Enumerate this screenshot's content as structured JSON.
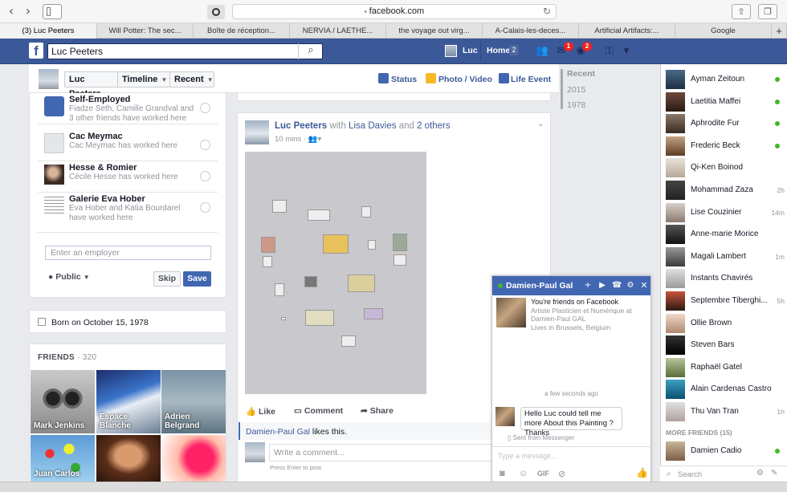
{
  "browser": {
    "url": "facebook.com",
    "tabs": [
      "(3) Luc Peeters",
      "Will Potter: The sec...",
      "Boîte de réception...",
      "NERVIA / LAETHE...",
      "the voyage out virg...",
      "A-Calais-les-deces...",
      "Artificial Artifacts:...",
      "Google"
    ],
    "new_tab": "+"
  },
  "topbar": {
    "logo": "f",
    "search_value": "Luc Peeters",
    "user": "Luc",
    "home": "Home",
    "home_count": "2",
    "messages_badge": "1",
    "notifications_badge": "2"
  },
  "profile_nav": {
    "name": "Luc Peeters",
    "timeline": "Timeline",
    "recent": "Recent",
    "status": "Status",
    "photo_video": "Photo / Video",
    "life_event": "Life Event"
  },
  "work": {
    "items": [
      {
        "name": "Self-Employed",
        "desc": "Fiadze Seth, Camille Grandval and 3 other friends have worked here"
      },
      {
        "name": "Cac Meymac",
        "desc": "Cac Meymac has worked here"
      },
      {
        "name": "Hesse & Romier",
        "desc": "Cécile Hesse has worked here"
      },
      {
        "name": "Galerie Eva Hober",
        "desc": "Eva Hober and Katia Bourdarel have worked here"
      }
    ],
    "employer_placeholder": "Enter an employer",
    "privacy": "Public",
    "skip": "Skip",
    "save": "Save"
  },
  "born": "Born on October 15, 1978",
  "friends": {
    "title": "FRIENDS",
    "count": "· 320",
    "tiles": [
      "Mark Jenkins",
      "Espace Blanche",
      "Adrien Belgrand",
      "Juan Carlos",
      "",
      ""
    ]
  },
  "post": {
    "author": "Luc Peeters",
    "with": " with ",
    "tagged": "Lisa Davies",
    "and": " and ",
    "others": "2 others",
    "time": "10 mins ·",
    "like": "Like",
    "comment": "Comment",
    "share": "Share",
    "liker": "Damien-Paul Gal",
    "likes_suffix": " likes this.",
    "comment_placeholder": "Write a comment...",
    "hint": "Press Enter to post."
  },
  "years": [
    "Recent",
    "2015",
    "1978"
  ],
  "chat": {
    "name": "Damien-Paul Gal",
    "friends_line": "You're friends on Facebook",
    "bio1": "Artiste Plasticien et Numérique at",
    "bio2": "Damien-Paul GAL",
    "bio3": "Lives in Brussels, Belgium",
    "timestamp": "a few seconds ago",
    "message": "Hello Luc could tell me more About this Painting ? Thanks",
    "sent_from": "Sent from Messenger",
    "input_placeholder": "Type a message...",
    "gif": "GIF"
  },
  "contacts": [
    {
      "name": "Ayman Zeitoun",
      "status": "online",
      "time": ""
    },
    {
      "name": "Laetitia Maffei",
      "status": "online",
      "time": ""
    },
    {
      "name": "Aphrodite Fur",
      "status": "online",
      "time": ""
    },
    {
      "name": "Frederic Beck",
      "status": "online",
      "time": ""
    },
    {
      "name": "Qi-Ken Boinod",
      "status": "",
      "time": ""
    },
    {
      "name": "Mohammad Zaza",
      "status": "",
      "time": "2h"
    },
    {
      "name": "Lise Couzinier",
      "status": "",
      "time": "14m"
    },
    {
      "name": "Anne-marie Morice",
      "status": "",
      "time": ""
    },
    {
      "name": "Magali Lambert",
      "status": "",
      "time": "1m"
    },
    {
      "name": "Instants Chavirés",
      "status": "",
      "time": ""
    },
    {
      "name": "Septembre Tiberghi...",
      "status": "",
      "time": "5h"
    },
    {
      "name": "Ollie Brown",
      "status": "",
      "time": ""
    },
    {
      "name": "Steven Bars",
      "status": "",
      "time": ""
    },
    {
      "name": "Raphaël Gatel",
      "status": "",
      "time": ""
    },
    {
      "name": "Alain Cardenas Castro",
      "status": "",
      "time": ""
    },
    {
      "name": "Thu Van Tran",
      "status": "",
      "time": "1h"
    }
  ],
  "more_friends": "MORE FRIENDS (15)",
  "more_contacts": [
    {
      "name": "Damien Cadio",
      "status": "online"
    }
  ],
  "sidebar_search": "Search"
}
